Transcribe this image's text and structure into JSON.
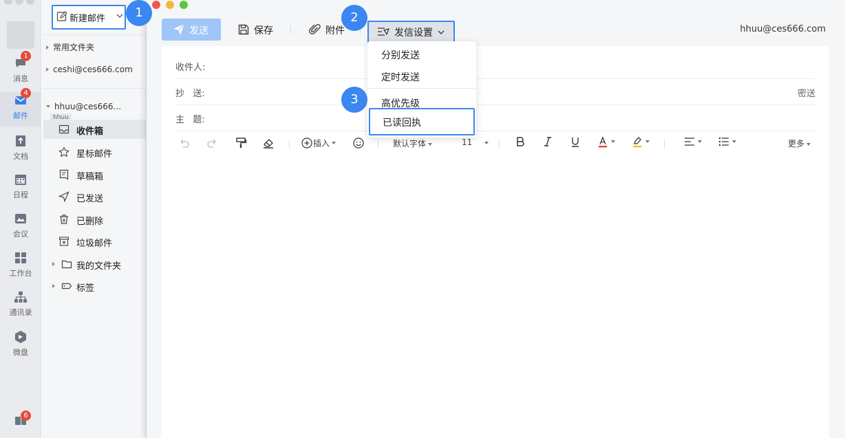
{
  "rail": {
    "items": [
      {
        "label": "消息",
        "badge": "1",
        "icon": "chat-icon"
      },
      {
        "label": "邮件",
        "badge": "4",
        "icon": "mail-icon"
      },
      {
        "label": "文档",
        "icon": "doc-icon"
      },
      {
        "label": "日程",
        "icon": "calendar-icon"
      },
      {
        "label": "会议",
        "icon": "meeting-icon"
      },
      {
        "label": "工作台",
        "icon": "grid-icon"
      },
      {
        "label": "通讯录",
        "icon": "contacts-icon"
      },
      {
        "label": "微盘",
        "icon": "drive-icon"
      }
    ],
    "bottom_badge": "6",
    "accent": "#3a7ee4"
  },
  "folders": {
    "compose_label": "新建邮件",
    "group_common": "常用文件夹",
    "group_ceshi": "ceshi@ces666.com",
    "group_hhuu": "hhuu@ces666...",
    "group_hhuu_tag": "hhuu",
    "items": [
      {
        "label": "收件箱",
        "icon": "inbox-icon"
      },
      {
        "label": "星标邮件",
        "icon": "star-icon"
      },
      {
        "label": "草稿箱",
        "icon": "draft-icon"
      },
      {
        "label": "已发送",
        "icon": "sent-icon"
      },
      {
        "label": "已删除",
        "icon": "trash-icon"
      },
      {
        "label": "垃圾邮件",
        "icon": "spam-icon"
      },
      {
        "label": "我的文件夹",
        "icon": "folder-icon"
      },
      {
        "label": "标签",
        "icon": "tag-icon"
      }
    ]
  },
  "toolbar": {
    "send_label": "发送",
    "save_label": "保存",
    "attach_label": "附件",
    "send_settings_label": "发信设置",
    "account": "hhuu@ces666.com"
  },
  "form": {
    "to_label": "收件人:",
    "cc_label": "抄   送:",
    "bcc_label": "密送",
    "subject_label": "主   题:"
  },
  "editor": {
    "insert_label": "插入",
    "font_label": "默认字体",
    "size_label": "11",
    "more_label": "更多"
  },
  "menu": {
    "items": [
      "分别发送",
      "定时发送",
      "高优先级",
      "已读回执"
    ]
  },
  "steps": [
    "1",
    "2",
    "3"
  ],
  "colors": {
    "highlight_border": "#3b86f0",
    "send_button": "#9fc6f6",
    "font_color_bar": "#e6413a",
    "highlight_color_bar": "#f2c200"
  }
}
